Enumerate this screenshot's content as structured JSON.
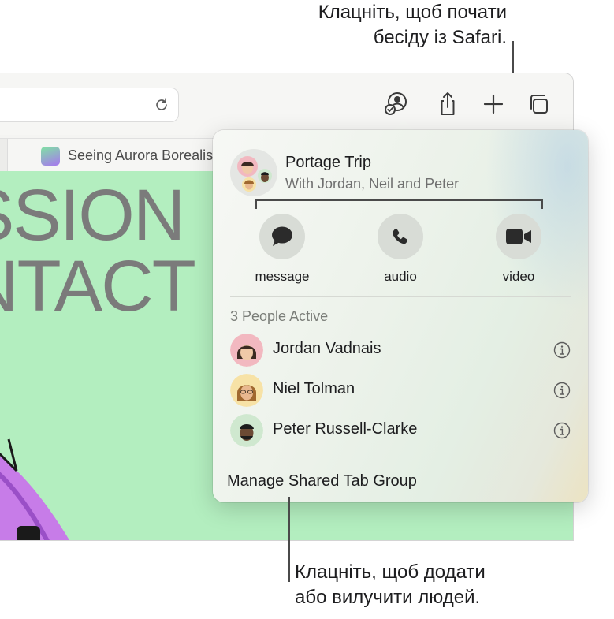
{
  "callouts": {
    "top_line1": "Клацніть, щоб почати",
    "top_line2": "бесіду із Safari.",
    "bottom_line1": "Клацніть, щоб додати",
    "bottom_line2": "або вилучити людей."
  },
  "browser": {
    "tab_title": "Seeing Aurora Borealis",
    "page_text_line1": "SSION",
    "page_text_line2": "NTACT"
  },
  "popover": {
    "group_name": "Portage Trip",
    "group_subtitle": "With Jordan, Neil and Peter",
    "actions": [
      {
        "label": "message",
        "icon": "message-bubble-icon"
      },
      {
        "label": "audio",
        "icon": "phone-icon"
      },
      {
        "label": "video",
        "icon": "video-camera-icon"
      }
    ],
    "section_title": "3 People Active",
    "people": [
      {
        "name": "Jordan Vadnais",
        "avatar_color": "#f2b8c0"
      },
      {
        "name": "Niel Tolman",
        "avatar_color": "#f7e2a6"
      },
      {
        "name": "Peter Russell-Clarke",
        "avatar_color": "#cfe8cf"
      }
    ],
    "manage_label": "Manage Shared Tab Group"
  },
  "colors": {
    "page_background": "#b3eebf",
    "action_circle": "#d8dcd6",
    "icon_dark": "#2b2b2b"
  }
}
